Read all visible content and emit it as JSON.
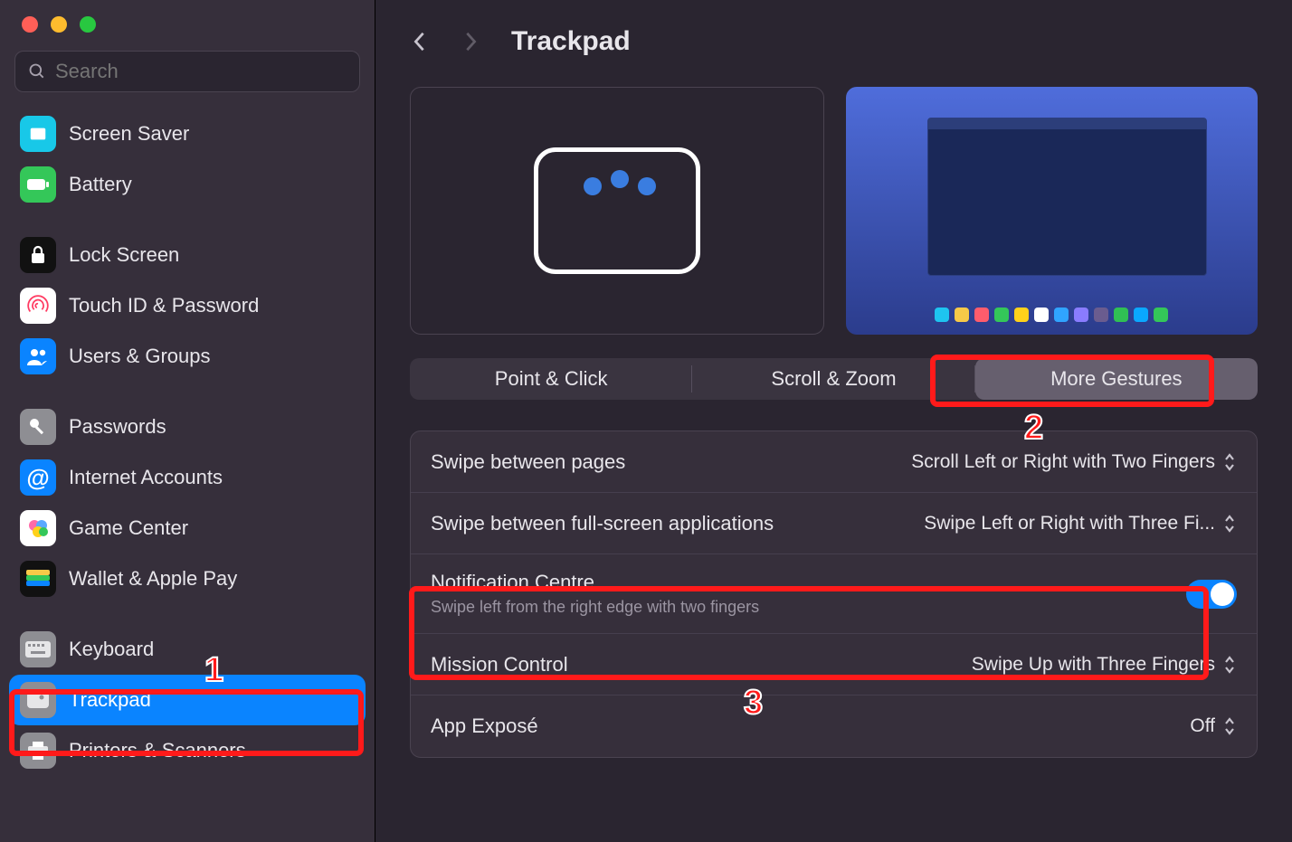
{
  "search": {
    "placeholder": "Search"
  },
  "sidebar": {
    "items": [
      {
        "label": "Screen Saver",
        "icon": "screensaver",
        "bg": "#18c8e8"
      },
      {
        "label": "Battery",
        "icon": "battery",
        "bg": "#34c759"
      },
      {
        "label": "Lock Screen",
        "icon": "lock",
        "bg": "#111"
      },
      {
        "label": "Touch ID & Password",
        "icon": "fingerprint",
        "bg": "#fff"
      },
      {
        "label": "Users & Groups",
        "icon": "users",
        "bg": "#0a84ff"
      },
      {
        "label": "Passwords",
        "icon": "key",
        "bg": "#8e8e93"
      },
      {
        "label": "Internet Accounts",
        "icon": "at",
        "bg": "#0a84ff"
      },
      {
        "label": "Game Center",
        "icon": "gamecenter",
        "bg": "#fff"
      },
      {
        "label": "Wallet & Apple Pay",
        "icon": "wallet",
        "bg": "#111"
      },
      {
        "label": "Keyboard",
        "icon": "keyboard",
        "bg": "#8e8e93"
      },
      {
        "label": "Trackpad",
        "icon": "trackpad",
        "bg": "#8e8e93",
        "selected": true
      },
      {
        "label": "Printers & Scanners",
        "icon": "printer",
        "bg": "#8e8e93"
      }
    ]
  },
  "header": {
    "title": "Trackpad"
  },
  "tabs": {
    "items": [
      {
        "label": "Point & Click"
      },
      {
        "label": "Scroll & Zoom"
      },
      {
        "label": "More Gestures",
        "active": true
      }
    ]
  },
  "settings": [
    {
      "label": "Swipe between pages",
      "value": "Scroll Left or Right with Two Fingers",
      "control": "select"
    },
    {
      "label": "Swipe between full-screen applications",
      "value": "Swipe Left or Right with Three Fi...",
      "control": "select"
    },
    {
      "label": "Notification Centre",
      "sub": "Swipe left from the right edge with two fingers",
      "control": "toggle",
      "on": true
    },
    {
      "label": "Mission Control",
      "value": "Swipe Up with Three Fingers",
      "control": "select"
    },
    {
      "label": "App Exposé",
      "value": "Off",
      "control": "select"
    }
  ],
  "annotations": {
    "one": "1",
    "two": "2",
    "three": "3"
  },
  "dock_colors": [
    "#1ec4f0",
    "#f7c948",
    "#ff5c6c",
    "#34c759",
    "#ffd11a",
    "#ffffff",
    "#30a4ff",
    "#8a7cff",
    "#6a5c8f",
    "#30c054",
    "#0aa8ff",
    "#34c759"
  ]
}
